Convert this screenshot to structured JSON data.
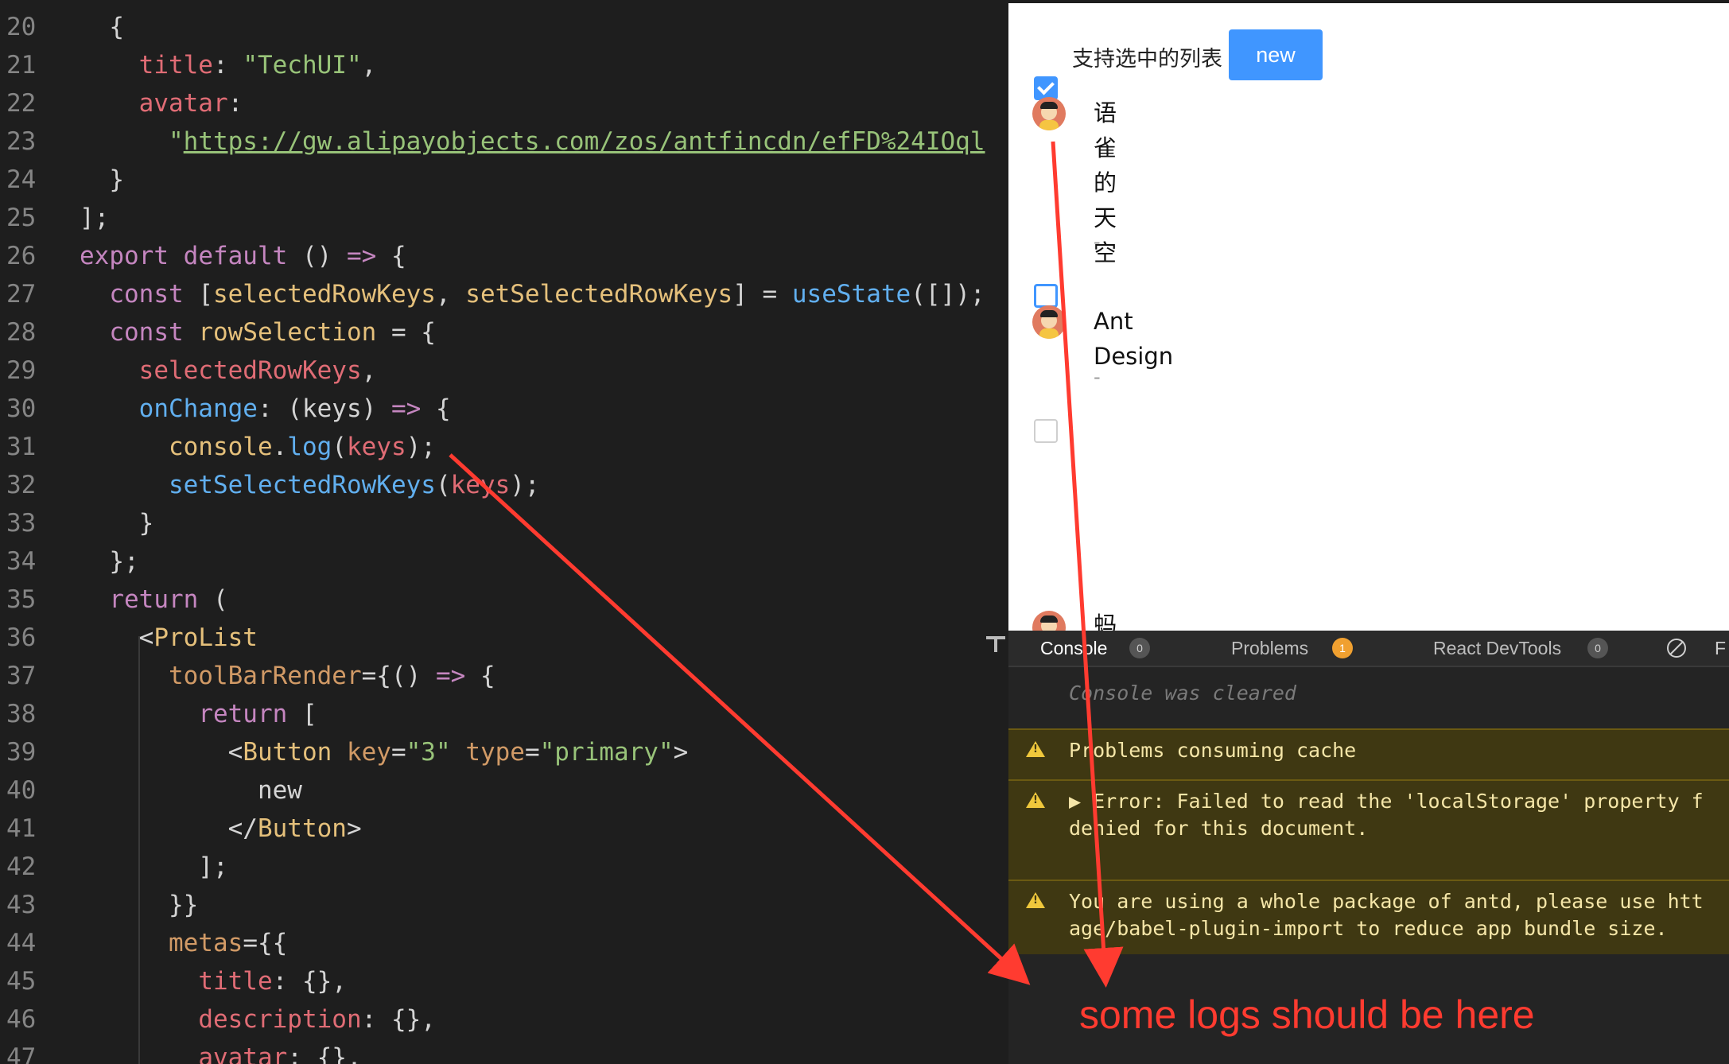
{
  "editor": {
    "lines": [
      {
        "n": "20",
        "tokens": [
          [
            "pun",
            "  {"
          ]
        ]
      },
      {
        "n": "21",
        "tokens": [
          [
            "pun",
            "    "
          ],
          [
            "prop",
            "title"
          ],
          [
            "pun",
            ": "
          ],
          [
            "str",
            "\"TechUI\""
          ],
          [
            "pun",
            ","
          ]
        ]
      },
      {
        "n": "22",
        "tokens": [
          [
            "pun",
            "    "
          ],
          [
            "prop",
            "avatar"
          ],
          [
            "pun",
            ":"
          ]
        ]
      },
      {
        "n": "23",
        "tokens": [
          [
            "pun",
            "      "
          ],
          [
            "str",
            "\""
          ],
          [
            "url",
            "https://gw.alipayobjects.com/zos/antfincdn/efFD%24IOql"
          ]
        ]
      },
      {
        "n": "24",
        "tokens": [
          [
            "pun",
            "  }"
          ]
        ]
      },
      {
        "n": "25",
        "tokens": [
          [
            "pun",
            "];"
          ]
        ]
      },
      {
        "n": "26",
        "tokens": [
          [
            "kw",
            "export"
          ],
          [
            "pun",
            " "
          ],
          [
            "kw",
            "default"
          ],
          [
            "pun",
            " () "
          ],
          [
            "kw",
            "=>"
          ],
          [
            "pun",
            " {"
          ]
        ]
      },
      {
        "n": "27",
        "tokens": [
          [
            "pun",
            "  "
          ],
          [
            "kw",
            "const"
          ],
          [
            "pun",
            " ["
          ],
          [
            "orange",
            "selectedRowKeys"
          ],
          [
            "pun",
            ", "
          ],
          [
            "orange",
            "setSelectedRowKeys"
          ],
          [
            "pun",
            "] = "
          ],
          [
            "fn",
            "useState"
          ],
          [
            "pun",
            "([]);"
          ]
        ]
      },
      {
        "n": "28",
        "tokens": [
          [
            "pun",
            "  "
          ],
          [
            "kw",
            "const"
          ],
          [
            "pun",
            " "
          ],
          [
            "orange",
            "rowSelection"
          ],
          [
            "pun",
            " = {"
          ]
        ]
      },
      {
        "n": "29",
        "tokens": [
          [
            "pun",
            "    "
          ],
          [
            "var",
            "selectedRowKeys"
          ],
          [
            "pun",
            ","
          ]
        ]
      },
      {
        "n": "30",
        "tokens": [
          [
            "pun",
            "    "
          ],
          [
            "fn",
            "onChange"
          ],
          [
            "pun",
            ": ("
          ],
          [
            "pun",
            "keys"
          ],
          [
            "pun",
            ") "
          ],
          [
            "kw",
            "=>"
          ],
          [
            "pun",
            " {"
          ]
        ]
      },
      {
        "n": "31",
        "tokens": [
          [
            "pun",
            "      "
          ],
          [
            "orange",
            "console"
          ],
          [
            "pun",
            "."
          ],
          [
            "fn",
            "log"
          ],
          [
            "pun",
            "("
          ],
          [
            "var",
            "keys"
          ],
          [
            "pun",
            ");"
          ]
        ]
      },
      {
        "n": "32",
        "tokens": [
          [
            "pun",
            "      "
          ],
          [
            "fn",
            "setSelectedRowKeys"
          ],
          [
            "pun",
            "("
          ],
          [
            "var",
            "keys"
          ],
          [
            "pun",
            ");"
          ]
        ]
      },
      {
        "n": "33",
        "tokens": [
          [
            "pun",
            "    }"
          ]
        ]
      },
      {
        "n": "34",
        "tokens": [
          [
            "pun",
            "  };"
          ]
        ]
      },
      {
        "n": "35",
        "tokens": [
          [
            "pun",
            "  "
          ],
          [
            "kw",
            "return"
          ],
          [
            "pun",
            " ("
          ]
        ]
      },
      {
        "n": "36",
        "tokens": [
          [
            "pun",
            "    <"
          ],
          [
            "tag",
            "ProList"
          ]
        ]
      },
      {
        "n": "37",
        "tokens": [
          [
            "pun",
            "      "
          ],
          [
            "attr",
            "toolBarRender"
          ],
          [
            "pun",
            "={() "
          ],
          [
            "kw",
            "=>"
          ],
          [
            "pun",
            " {"
          ]
        ]
      },
      {
        "n": "38",
        "tokens": [
          [
            "pun",
            "        "
          ],
          [
            "kw",
            "return"
          ],
          [
            "pun",
            " ["
          ]
        ]
      },
      {
        "n": "39",
        "tokens": [
          [
            "pun",
            "          <"
          ],
          [
            "tag",
            "Button"
          ],
          [
            "pun",
            " "
          ],
          [
            "attr",
            "key"
          ],
          [
            "pun",
            "="
          ],
          [
            "str",
            "\"3\""
          ],
          [
            "pun",
            " "
          ],
          [
            "attr",
            "type"
          ],
          [
            "pun",
            "="
          ],
          [
            "str",
            "\"primary\""
          ],
          [
            "pun",
            ">"
          ]
        ]
      },
      {
        "n": "40",
        "tokens": [
          [
            "pun",
            "            new"
          ]
        ]
      },
      {
        "n": "41",
        "tokens": [
          [
            "pun",
            "          </"
          ],
          [
            "tag",
            "Button"
          ],
          [
            "pun",
            ">"
          ]
        ]
      },
      {
        "n": "42",
        "tokens": [
          [
            "pun",
            "        ];"
          ]
        ]
      },
      {
        "n": "43",
        "tokens": [
          [
            "pun",
            "      }}"
          ]
        ]
      },
      {
        "n": "44",
        "tokens": [
          [
            "pun",
            "      "
          ],
          [
            "attr",
            "metas"
          ],
          [
            "pun",
            "={{"
          ]
        ]
      },
      {
        "n": "45",
        "tokens": [
          [
            "pun",
            "        "
          ],
          [
            "prop",
            "title"
          ],
          [
            "pun",
            ": {},"
          ]
        ]
      },
      {
        "n": "46",
        "tokens": [
          [
            "pun",
            "        "
          ],
          [
            "prop",
            "description"
          ],
          [
            "pun",
            ": {},"
          ]
        ]
      },
      {
        "n": "47",
        "tokens": [
          [
            "pun",
            "        "
          ],
          [
            "prop",
            "avatar"
          ],
          [
            "pun",
            ": {},"
          ]
        ]
      }
    ]
  },
  "preview": {
    "toolbar_title": "支持选中的列表",
    "new_button": "new",
    "items": [
      {
        "title": "语雀的天空",
        "desc": "-",
        "checked": true
      },
      {
        "title": "Ant Design",
        "desc": "-",
        "checked": false
      },
      {
        "title": "蚂",
        "desc": "",
        "checked": false
      }
    ]
  },
  "console": {
    "tabs": [
      {
        "label": "Console",
        "count": "0"
      },
      {
        "label": "Problems",
        "count": "1"
      },
      {
        "label": "React DevTools",
        "count": "0"
      }
    ],
    "filter_letter": "F",
    "cleared_text": "Console was cleared",
    "warnings": [
      "Problems consuming cache",
      "▶ Error: Failed to read the 'localStorage' property f\ndenied for this document.",
      "You are using a whole package of antd, please use htt\nage/babel-plugin-import to reduce app bundle size."
    ]
  },
  "annotation": {
    "text": "some logs should be here",
    "color": "#ff3b30"
  },
  "colors": {
    "editor_bg": "#1e1e1e",
    "primary_blue": "#4096ff",
    "warning_bg": "#3f3812"
  }
}
